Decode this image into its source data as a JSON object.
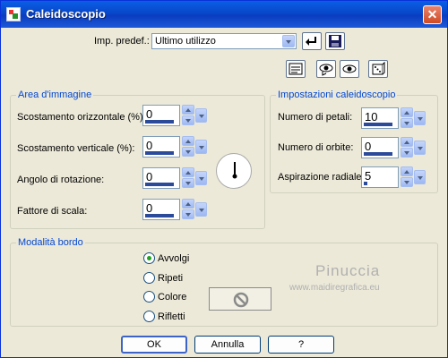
{
  "window": {
    "title": "Caleidoscopio",
    "close_glyph": "✕"
  },
  "presets": {
    "label": "Imp. predef.:",
    "selected": "Ultimo utilizzo",
    "icons": [
      "apply-preset-icon",
      "save-preset-icon"
    ]
  },
  "toolbar": {
    "icons": [
      "list-icon",
      "eye-reset-icon",
      "eye-preview-icon",
      "dice-random-icon"
    ]
  },
  "image_area": {
    "legend": "Area d'immagine",
    "fields": [
      {
        "label": "Scostamento orizzontale (%):",
        "value": "0"
      },
      {
        "label": "Scostamento verticale (%):",
        "value": "0"
      },
      {
        "label": "Angolo di rotazione:",
        "value": "0"
      },
      {
        "label": "Fattore di scala:",
        "value": "0"
      }
    ]
  },
  "kaleido_settings": {
    "legend": "Impostazioni caleidoscopio",
    "fields": [
      {
        "label": "Numero di petali:",
        "value": "10"
      },
      {
        "label": "Numero di orbite:",
        "value": "0"
      },
      {
        "label": "Aspirazione radiale:",
        "value": "5"
      }
    ]
  },
  "edge_mode": {
    "legend": "Modalità bordo",
    "options": [
      {
        "label": "Avvolgi",
        "selected": true
      },
      {
        "label": "Ripeti",
        "selected": false
      },
      {
        "label": "Colore",
        "selected": false
      },
      {
        "label": "Rifletti",
        "selected": false
      }
    ]
  },
  "watermark": {
    "name": "Pinuccia",
    "url": "www.maidiregrafica.eu"
  },
  "buttons": {
    "ok": "OK",
    "cancel": "Annulla",
    "help": "?"
  },
  "colors": {
    "title_bar": "#0a4fd8",
    "accent": "#0046d5",
    "dialog_bg": "#ece9d8"
  }
}
